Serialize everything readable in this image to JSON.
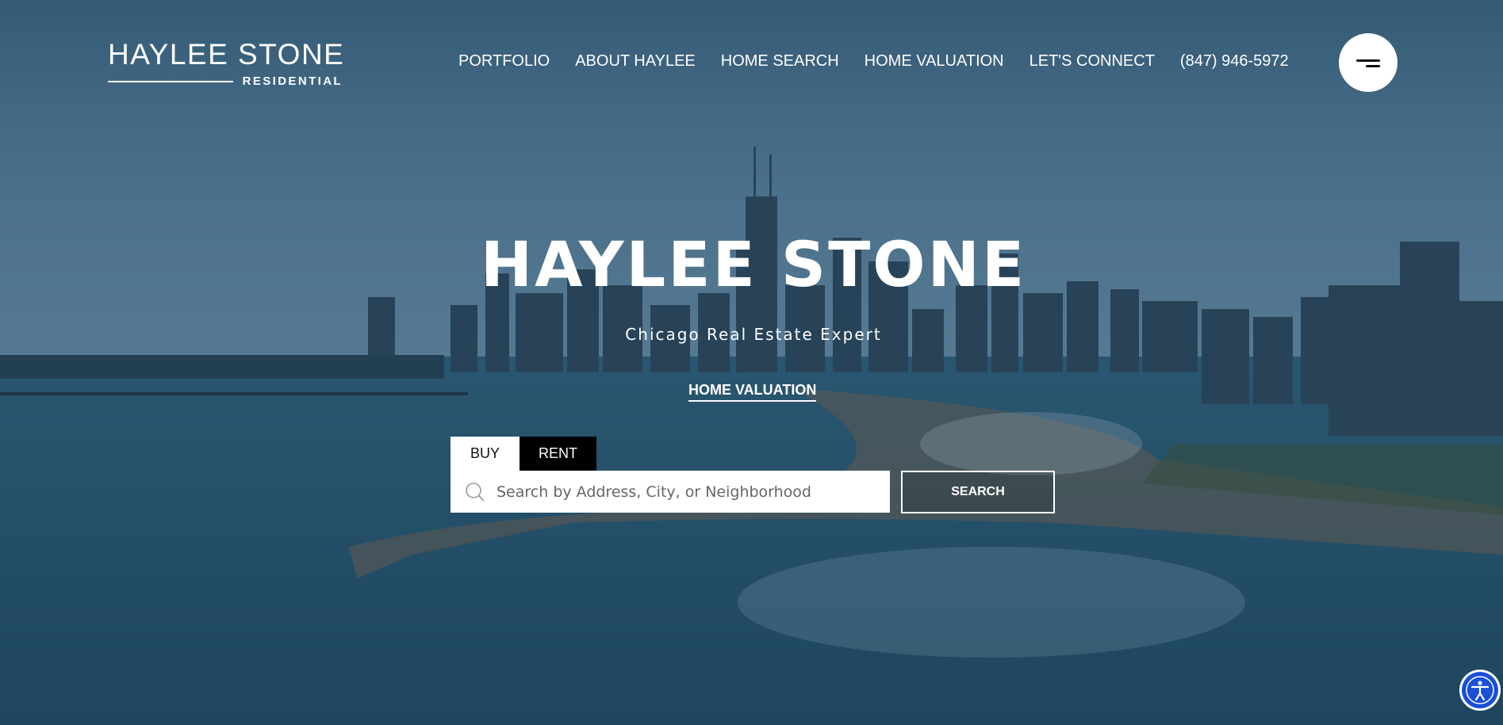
{
  "header": {
    "logo_main": "HAYLEE STONE",
    "logo_sub": "RESIDENTIAL",
    "nav": [
      "PORTFOLIO",
      "ABOUT HAYLEE",
      "HOME SEARCH",
      "HOME VALUATION",
      "LET'S CONNECT",
      "(847) 946-5972"
    ],
    "menu_icon": "hamburger-menu-icon"
  },
  "hero": {
    "title": "HAYLEE STONE",
    "subtitle": "Chicago Real Estate Expert",
    "cta_label": "HOME VALUATION"
  },
  "search": {
    "tabs": [
      "BUY",
      "RENT"
    ],
    "active_tab": "BUY",
    "placeholder": "Search by Address, City, or Neighborhood",
    "value": "",
    "button_label": "SEARCH",
    "icon": "search-icon"
  },
  "accessibility": {
    "icon": "accessibility-icon",
    "color": "#1a4fd6"
  },
  "colors": {
    "overlay": "#2f5f7a",
    "text": "#ffffff",
    "tab_active_bg": "#ffffff",
    "tab_inactive_bg": "#000000"
  }
}
